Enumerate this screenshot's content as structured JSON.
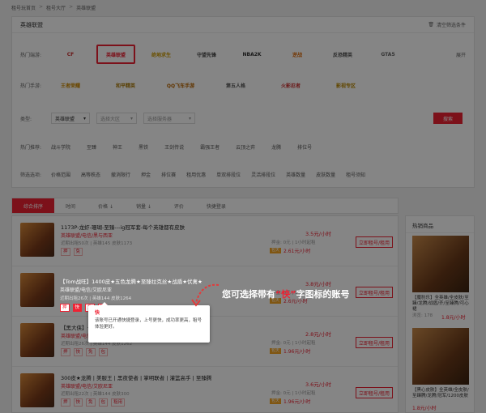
{
  "breadcrumb": [
    "租号玩首页",
    "租号大厅",
    "英雄联盟"
  ],
  "filter": {
    "title": "英雄联盟",
    "clear_label": "清空筛选条件",
    "hot_games_label": "热门端游:",
    "hot_mobile_label": "热门手游:",
    "more_label": "展开",
    "games": [
      "CF",
      "英雄联盟",
      "绝地求生",
      "守望先锋",
      "NBA2K",
      "逆战",
      "反恐精英",
      "GTA5"
    ],
    "mobile": [
      "王者荣耀",
      "和平精英",
      "QQ飞车手游",
      "第五人格",
      "火影忍者",
      "影视专区"
    ],
    "type_label": "类型:",
    "selects": [
      {
        "value": "英雄联盟",
        "placeholder": "英雄联盟"
      },
      {
        "value": "",
        "placeholder": "选择大区"
      },
      {
        "value": "",
        "placeholder": "选择服务器"
      }
    ],
    "search_label": "搜索",
    "heroes_label": "热门推荐:",
    "heroes": [
      "战斗学院",
      "至臻",
      "神王",
      "黑铁",
      "王剑传说",
      "霸强王者",
      "云顶之弈",
      "龙腾",
      "排位号"
    ],
    "filters_label": "筛选选项:",
    "filter_tags": [
      "价格范围",
      "高等秩态",
      "撤消限行",
      "押金",
      "排位赛",
      "租用优惠",
      "单双排段位",
      "灵活排段位",
      "英雄数量",
      "皮肤数量",
      "租号须知"
    ]
  },
  "sort": {
    "tabs": [
      "综合排序",
      "时间",
      "价格 ↓",
      "销量 ↓",
      "评价",
      "快捷登录"
    ]
  },
  "items": [
    {
      "title": "1173P-龙虾-珊瑚-至臻---ig冠军套-每个英雄都有皮肤",
      "sub": "英雄联盟/电信/黑与西亚",
      "meta": "近期出租50次 | 英雄145 皮肤1173",
      "badges": [
        "押",
        "免"
      ],
      "price": "3.5元/小时",
      "deposit": "押金: 0元 | 1小时起租",
      "price2_tag": "包天",
      "price2": "2.61元/小时",
      "rent": "立即租号/租用"
    },
    {
      "title": "【Tom战旺】1400皮★五色龙腾★至臻拉克丝★战盾★伏禽★",
      "sub": "英雄联盟/电信/艾欧尼亚",
      "meta": "近期出租26次 | 英雄144 皮肤1264",
      "badges": [
        "押",
        "快",
        "免",
        "快"
      ],
      "price": "3.8元/小时",
      "deposit": "押金: 0元 | 1小时起租",
      "price2_tag": "包天",
      "price2": "2.6元/小时",
      "rent": "立即租号/租用"
    },
    {
      "title": "【黑大侠】★★★全皮肤★★★至臻★★★战盾★★★",
      "sub": "英雄联盟/电信/黑色玫瑰",
      "meta": "近期出租26次 | 英雄144 皮肤1262",
      "badges": [
        "押",
        "快",
        "免",
        "包"
      ],
      "price": "2.8元/小时",
      "deposit": "押金: 0元 | 1小时起租",
      "price2_tag": "包天",
      "price2": "1.96元/小时",
      "rent": "立即租号/租用"
    },
    {
      "title": "300皮★龙腾 | 美服王 | 黑夜使者 | 掌明联者 | 灌篮高手 | 至臻腾",
      "sub": "英雄联盟/电信/艾欧尼亚",
      "meta": "近期出租22次 | 英雄144 皮肤300",
      "badges": [
        "押",
        "快",
        "免",
        "包",
        "租用"
      ],
      "price": "3.6元/小时",
      "deposit": "押金: 0元 | 1小时起租",
      "price2_tag": "包天",
      "price2": "1.96元/小时",
      "rent": "立即租号/租用"
    }
  ],
  "hot": {
    "title": "热销商品",
    "items": [
      {
        "text": "【魔豹乐】全英雄/全皮肤/至臻/龙腾/战盾/齐/至臻腾/可心裙",
        "views": "浏览: 178",
        "price": "1.8元/小时"
      },
      {
        "text": "【黑心皮肤】全英雄/全皮肤/至臻腾/龙腾/冠军/1200皮肤",
        "views": "",
        "price": "1.8元/小时"
      }
    ]
  },
  "tooltip": {
    "title": "快",
    "body": "该账号已开通快捷登录，上号更快，成功率更高，租号体验更好。"
  },
  "callout": {
    "before": "您可选择带有",
    "quote": "“快”",
    "after": "字图标的账号"
  },
  "colors": {
    "accent": "#e23b3b",
    "orange": "#f5a623"
  }
}
